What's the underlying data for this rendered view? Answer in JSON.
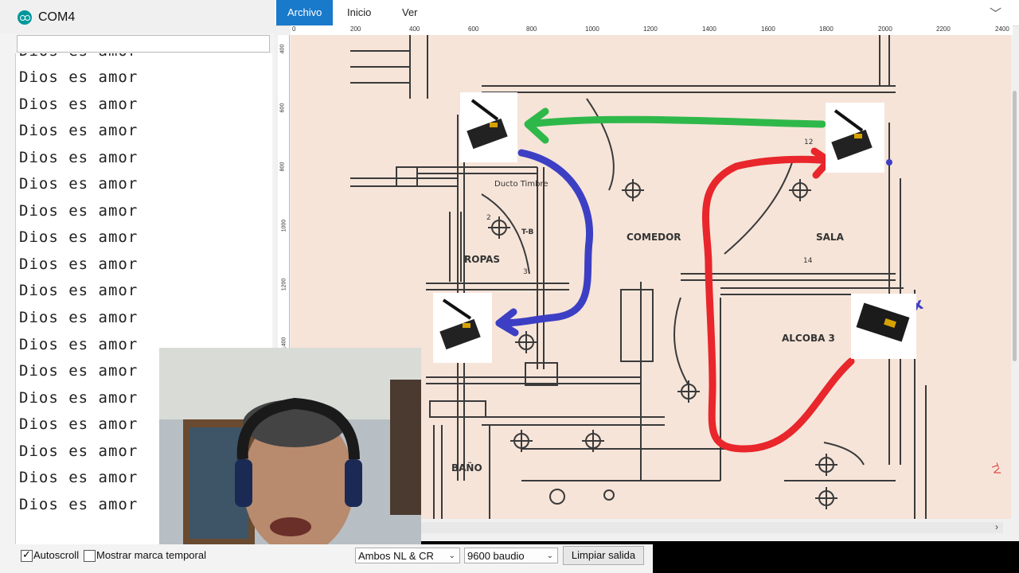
{
  "serial": {
    "title": "COM4",
    "lines": [
      "Dios es amor",
      "Dios es amor",
      "Dios es amor",
      "Dios es amor",
      "Dios es amor",
      "Dios es amor",
      "Dios es amor",
      "Dios es amor",
      "Dios es amor",
      "Dios es amor",
      "Dios es amor",
      "Dios es amor",
      "Dios es amor",
      "Dios es amor",
      "Dios es amor",
      "Dios es amor",
      "Dios es amor",
      "Dios es amor"
    ],
    "autoscroll_label": "Autoscroll",
    "autoscroll_checked": true,
    "timestamp_label": "Mostrar marca temporal",
    "timestamp_checked": false,
    "line_ending": "Ambos NL & CR",
    "baud_rate": "9600 baudio",
    "clear_button": "Limpiar salida"
  },
  "drawapp": {
    "tabs": [
      "Archivo",
      "Inicio",
      "Ver"
    ],
    "active_tab": "Archivo",
    "ruler_h": [
      "0",
      "200",
      "400",
      "600",
      "800",
      "1000",
      "1200",
      "1400",
      "1600",
      "1800",
      "2000",
      "2200",
      "2400"
    ],
    "ruler_v": [
      "400",
      "600",
      "800",
      "1000",
      "1200",
      "1400"
    ]
  },
  "floorplan": {
    "rooms": [
      "COMEDOR",
      "SALA",
      "ROPAS",
      "ALCOBA  3",
      "BAÑO",
      "Ducto Timbre"
    ],
    "marks": [
      "T-B",
      "12",
      "2",
      "3",
      "14",
      "TV",
      "Tx"
    ]
  },
  "colors": {
    "accent": "#1979ca",
    "arrow_green": "#2fb84a",
    "arrow_red": "#e8262b",
    "arrow_blue": "#3c3fc4",
    "paper": "#f6e4d9"
  }
}
